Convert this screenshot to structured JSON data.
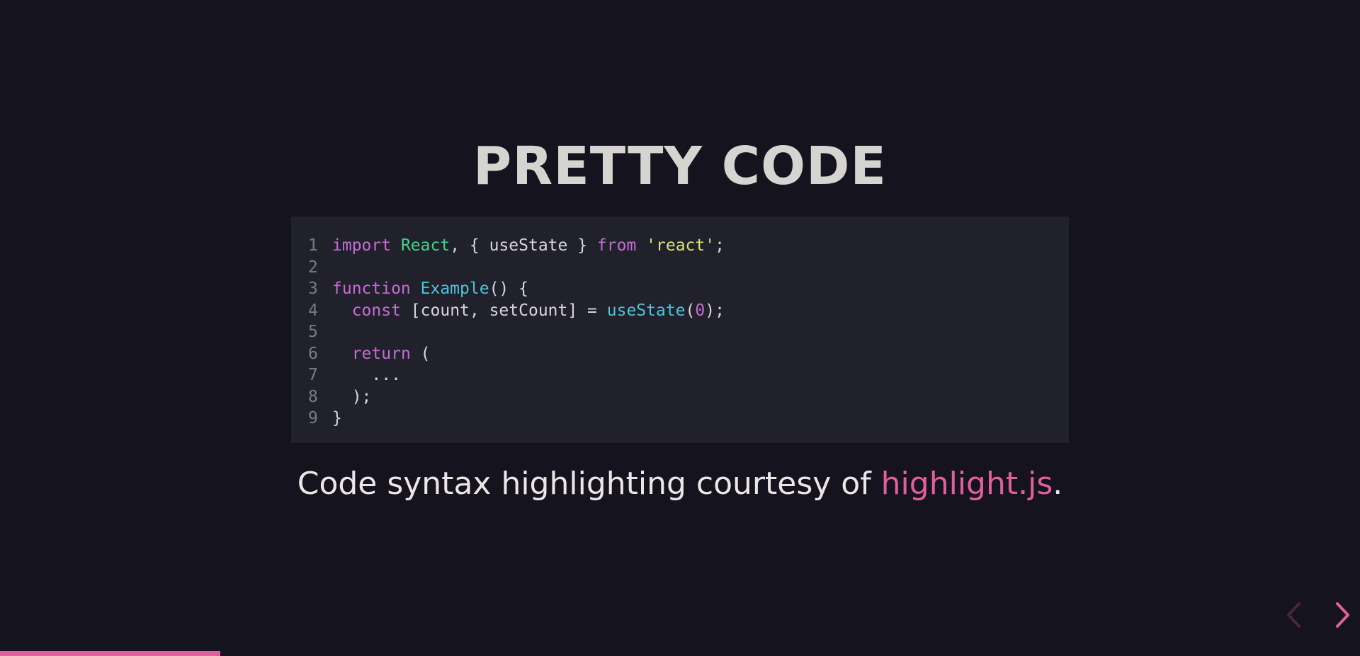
{
  "slide": {
    "title": "PRETTY CODE",
    "caption_prefix": "Code syntax highlighting courtesy of ",
    "caption_link": "highlight.js",
    "caption_suffix": "."
  },
  "code": {
    "lines": [
      {
        "num": "1",
        "tokens": [
          {
            "t": "import",
            "c": "kw"
          },
          {
            "t": " ",
            "c": ""
          },
          {
            "t": "React",
            "c": "ti"
          },
          {
            "t": ", { useState } ",
            "c": ""
          },
          {
            "t": "from",
            "c": "kw"
          },
          {
            "t": " ",
            "c": ""
          },
          {
            "t": "'react'",
            "c": "st"
          },
          {
            "t": ";",
            "c": ""
          }
        ]
      },
      {
        "num": "2",
        "tokens": []
      },
      {
        "num": "3",
        "tokens": [
          {
            "t": "function",
            "c": "kw"
          },
          {
            "t": " ",
            "c": ""
          },
          {
            "t": "Example",
            "c": "fn"
          },
          {
            "t": "() {",
            "c": ""
          }
        ]
      },
      {
        "num": "4",
        "tokens": [
          {
            "t": "  ",
            "c": ""
          },
          {
            "t": "const",
            "c": "kw"
          },
          {
            "t": " [count, setCount] = ",
            "c": ""
          },
          {
            "t": "useState",
            "c": "fn"
          },
          {
            "t": "(",
            "c": ""
          },
          {
            "t": "0",
            "c": "nu"
          },
          {
            "t": ");",
            "c": ""
          }
        ]
      },
      {
        "num": "5",
        "tokens": []
      },
      {
        "num": "6",
        "tokens": [
          {
            "t": "  ",
            "c": ""
          },
          {
            "t": "return",
            "c": "kw"
          },
          {
            "t": " (",
            "c": ""
          }
        ]
      },
      {
        "num": "7",
        "tokens": [
          {
            "t": "    ...",
            "c": ""
          }
        ]
      },
      {
        "num": "8",
        "tokens": [
          {
            "t": "  );",
            "c": ""
          }
        ]
      },
      {
        "num": "9",
        "tokens": [
          {
            "t": "}",
            "c": ""
          }
        ]
      }
    ]
  },
  "navigation": {
    "prev_icon": "chevron-left-icon",
    "next_icon": "chevron-right-icon",
    "prev_enabled": false,
    "next_enabled": true
  },
  "progress": {
    "fraction": 0.162
  },
  "colors": {
    "background": "#15131e",
    "code_background": "#21212b",
    "accent": "#e0609c",
    "title": "#d6d4d0",
    "keyword": "#c66bd2",
    "class_name": "#3fd586",
    "function": "#4cc3d8",
    "string": "#d9e27a"
  }
}
